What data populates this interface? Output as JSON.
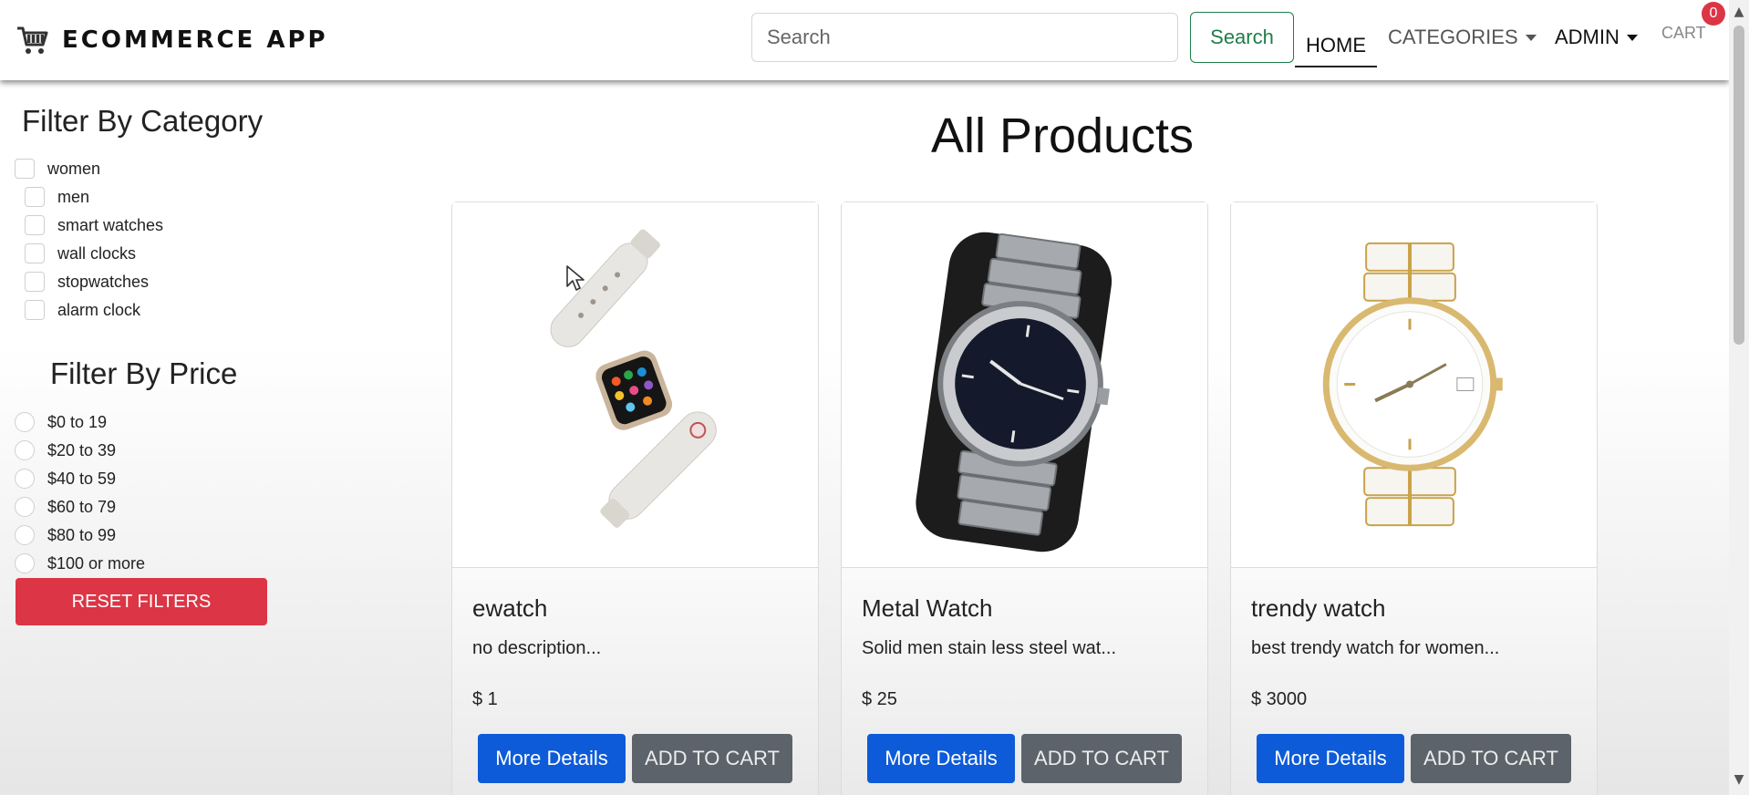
{
  "navbar": {
    "brand": "ECOMMERCE APP",
    "brand_icon": "shopping-cart-icon",
    "search_placeholder": "Search",
    "search_button": "Search",
    "links": {
      "home": "HOME",
      "categories": "CATEGORIES",
      "admin": "ADMIN",
      "cart": "CART"
    },
    "cart_count": "0"
  },
  "sidebar": {
    "category_heading": "Filter By Category",
    "categories": [
      "women",
      "men",
      "smart watches",
      "wall clocks",
      "stopwatches",
      "alarm clock"
    ],
    "price_heading": "Filter By Price",
    "prices": [
      "$0 to 19",
      "$20 to 39",
      "$40 to 59",
      "$60 to 79",
      "$80 to 99",
      "$100 or more"
    ],
    "reset_label": "RESET FILTERS"
  },
  "main": {
    "title": "All Products",
    "products": [
      {
        "name": "ewatch",
        "description": "no description...",
        "price": "$ 1",
        "details_label": "More Details",
        "cart_label": "ADD TO CART",
        "image": "smartwatch-image"
      },
      {
        "name": "Metal Watch",
        "description": "Solid men stain less steel wat...",
        "price": "$ 25",
        "details_label": "More Details",
        "cart_label": "ADD TO CART",
        "image": "metal-watch-image"
      },
      {
        "name": "trendy watch",
        "description": "best trendy watch for women...",
        "price": "$ 3000",
        "details_label": "More Details",
        "cart_label": "ADD TO CART",
        "image": "ceramic-watch-image"
      }
    ]
  },
  "colors": {
    "primary": "#0d5bd8",
    "secondary": "#5c636a",
    "danger": "#dc3545",
    "success": "#1e7e4a"
  }
}
